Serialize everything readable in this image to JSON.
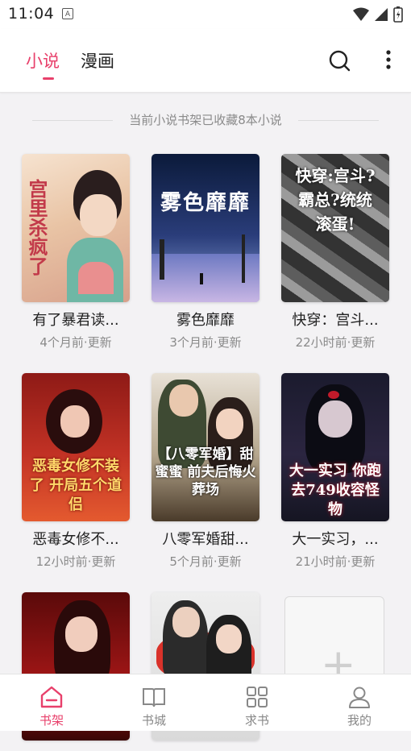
{
  "status": {
    "time": "11:04",
    "notif_icon": "A"
  },
  "appbar": {
    "tabs": [
      {
        "label": "小说",
        "active": true
      },
      {
        "label": "漫画",
        "active": false
      }
    ],
    "accent": "#e8406b",
    "search_icon": "search-icon",
    "more_icon": "more-vertical-icon"
  },
  "shelf": {
    "notice": "当前小说书架已收藏8本小说",
    "books": [
      {
        "title": "有了暴君读...",
        "update": "4个月前·更新",
        "cover_text": "宫里杀疯了"
      },
      {
        "title": "雾色靡靡",
        "update": "3个月前·更新",
        "cover_text": "雾色靡靡"
      },
      {
        "title": "快穿：宫斗...",
        "update": "22小时前·更新",
        "cover_text": "快穿:宫斗?霸总?统统滚蛋!"
      },
      {
        "title": "恶毒女修不...",
        "update": "12小时前·更新",
        "cover_text": "恶毒女修不装了 开局五个道侣"
      },
      {
        "title": "八零军婚甜...",
        "update": "5个月前·更新",
        "cover_text": "【八零军婚】甜蜜蜜 前夫后悔火葬场"
      },
      {
        "title": "大一实习，...",
        "update": "21小时前·更新",
        "cover_text": "大一实习 你跑去749收容怪物"
      },
      {
        "title": "",
        "update": "",
        "cover_text": ""
      },
      {
        "title": "",
        "update": "",
        "cover_text": ""
      }
    ],
    "add_label": "+"
  },
  "bottom_nav": [
    {
      "label": "书架",
      "icon": "bookshelf-home-icon",
      "active": true
    },
    {
      "label": "书城",
      "icon": "open-book-icon",
      "active": false
    },
    {
      "label": "求书",
      "icon": "grid-icon",
      "active": false
    },
    {
      "label": "我的",
      "icon": "user-icon",
      "active": false
    }
  ]
}
